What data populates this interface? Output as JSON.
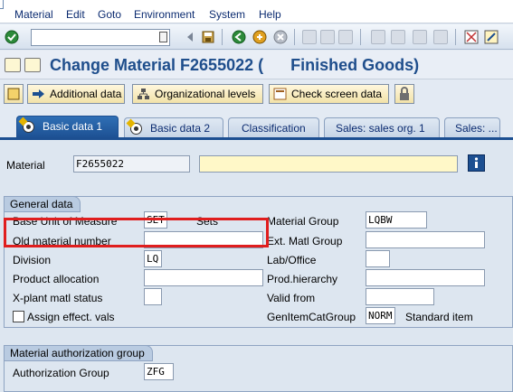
{
  "menu": {
    "items": [
      "Material",
      "Edit",
      "Goto",
      "Environment",
      "System",
      "Help"
    ]
  },
  "title": {
    "text": "Change Material F2655022 (      Finished Goods)"
  },
  "toolbar": {
    "additional_data": "Additional data",
    "org_levels": "Organizational levels",
    "check_screen": "Check screen data"
  },
  "tabs": [
    {
      "label": "Basic data 1",
      "active": true
    },
    {
      "label": "Basic data 2",
      "active": false
    },
    {
      "label": "Classification",
      "active": false
    },
    {
      "label": "Sales: sales org. 1",
      "active": false
    },
    {
      "label": "Sales: ...",
      "active": false
    }
  ],
  "header": {
    "material_label": "Material",
    "material_value": "F2655022",
    "description_value": ""
  },
  "general": {
    "title": "General data",
    "left": [
      {
        "label": "Base Unit of Measure",
        "value": "SET",
        "extra": "Sets"
      },
      {
        "label": "Old material number",
        "value": ""
      },
      {
        "label": "Division",
        "value": "LQ"
      },
      {
        "label": "Product allocation",
        "value": ""
      },
      {
        "label": "X-plant matl status",
        "value": ""
      }
    ],
    "right": [
      {
        "label": "Material Group",
        "value": "LQBW"
      },
      {
        "label": "Ext. Matl Group",
        "value": ""
      },
      {
        "label": "Lab/Office",
        "value": ""
      },
      {
        "label": "Prod.hierarchy",
        "value": ""
      },
      {
        "label": "Valid from",
        "value": ""
      },
      {
        "label": "GenItemCatGroup",
        "value": "NORM",
        "extra": "Standard item"
      }
    ],
    "assign_label": "Assign effect. vals"
  },
  "auth": {
    "title": "Material authorization group",
    "label": "Authorization Group",
    "value": "ZFG"
  },
  "colors": {
    "title_blue": "#1f4e8c",
    "tab_active": "#1c4f91",
    "highlight_red": "#e01e1e"
  }
}
